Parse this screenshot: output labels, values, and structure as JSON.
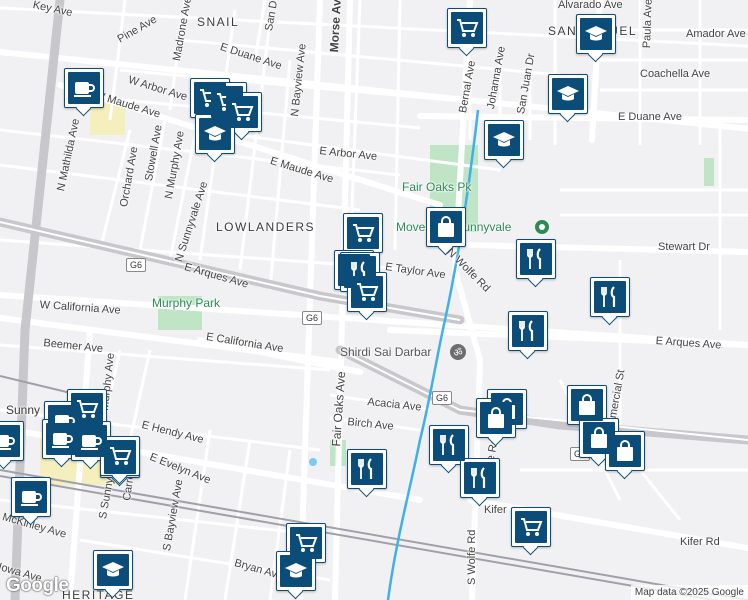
{
  "map": {
    "attribution": "Map data ©2025 Google",
    "logo": "Google",
    "colors": {
      "background": "#f1f0f3",
      "road": "#ffffff",
      "highway": "#c8c8cc",
      "rail": "#a0a0a8",
      "water": "#3fb0e8",
      "park": "#bfe5c6",
      "urban": "#f5eebd",
      "marker": "#0b4c78"
    },
    "labels": {
      "snail": "SNAIL",
      "lowlanders": "LOWLANDERS",
      "san_miguel": "SAN MIGUEL",
      "heritage": "HERITAGE",
      "sunnyvale": "Sunny",
      "murphy_park": "Murphy Park",
      "fair_oaks_park": "Fair Oaks Pk",
      "movement": "Movement Sunnyvale",
      "shirdi": "Shirdi Sai Darbar",
      "e_maude_ave": "E Maude Ave",
      "w_maude_ave": "W Maude Ave",
      "w_arbor_ave": "W Arbor Ave",
      "e_arbor_ave": "E Arbor Ave",
      "e_duane_ave_top": "E Duane Ave",
      "e_duane_ave_right": "E Duane Ave",
      "amador_ave": "Amador Ave",
      "coachella_ave": "Coachella Ave",
      "alvarado_ave": "Alvarado Ave",
      "stewart_dr": "Stewart Dr",
      "e_arques_ave_left": "E Arques Ave",
      "e_arques_ave_right": "E Arques Ave",
      "e_taylor_ave": "E Taylor Ave",
      "n_wolfe_rd": "N Wolfe Rd",
      "s_wolfe_rd": "S Wolfe Rd",
      "wolfe_rd_mid": "Wolfe Rd",
      "w_california_ave": "W California Ave",
      "e_california_ave": "E California Ave",
      "beemer_ave": "Beemer Ave",
      "acacia_ave": "Acacia Ave",
      "birch_ave": "Birch Ave",
      "e_hendy_ave": "E Hendy Ave",
      "e_evelyn_ave": "E Evelyn Ave",
      "kifer_rd_right": "Kifer Rd",
      "kifer_rd_mid": "Kifer",
      "mckinley_ave": "McKinley Ave",
      "iowa_ave": "Iowa Ave",
      "bryan_ave": "Bryan Ave",
      "n_mathilda_ave": "N Mathilda Ave",
      "n_sunnyvale_ave": "N Sunnyvale Ave",
      "s_sunnyvale_ave": "S Sunnyvale Ave",
      "s_murphy_ave": "Murphy Ave",
      "n_murphy_ave": "N Murphy Ave",
      "stowell_ave": "Stowell Ave",
      "orchard_ave": "Orchard Ave",
      "pine_ave": "Pine Ave",
      "madrone_ave": "Madrone Ave",
      "morse_ave": "Morse Ave",
      "n_bayview_ave": "N Bayview Ave",
      "s_bayview_ave": "S Bayview Ave",
      "fair_oaks_ave": "Fair Oaks Ave",
      "bernal_ave": "Bernal Ave",
      "johanna_ave": "Johanna Ave",
      "san_juan_dr": "San Juan Dr",
      "commercial_st": "Commercial St",
      "paula_ave": "Paula Ave",
      "carroll_st": "Carroll St",
      "key_ave": "Key Ave",
      "san_d": "San D",
      "g6_a": "G6",
      "g6_b": "G6",
      "g6_c": "G6",
      "g6_d": "G6"
    },
    "markers": [
      {
        "type": "grocery"
      },
      {
        "type": "school"
      },
      {
        "type": "cafe"
      },
      {
        "type": "grocery"
      },
      {
        "type": "grocery"
      },
      {
        "type": "grocery"
      },
      {
        "type": "school"
      },
      {
        "type": "school"
      },
      {
        "type": "school"
      },
      {
        "type": "grocery"
      },
      {
        "type": "shopping"
      },
      {
        "type": "restaurant"
      },
      {
        "type": "restaurant"
      },
      {
        "type": "grocery"
      },
      {
        "type": "restaurant"
      },
      {
        "type": "restaurant"
      },
      {
        "type": "restaurant"
      },
      {
        "type": "grocery"
      },
      {
        "type": "grocery"
      },
      {
        "type": "cafe"
      },
      {
        "type": "cafe"
      },
      {
        "type": "cafe"
      },
      {
        "type": "cafe"
      },
      {
        "type": "cafe"
      },
      {
        "type": "grocery"
      },
      {
        "type": "restaurant"
      },
      {
        "type": "restaurant"
      },
      {
        "type": "shopping"
      },
      {
        "type": "shopping"
      },
      {
        "type": "shopping"
      },
      {
        "type": "shopping"
      },
      {
        "type": "shopping"
      },
      {
        "type": "grocery"
      },
      {
        "type": "grocery"
      },
      {
        "type": "school"
      },
      {
        "type": "school"
      },
      {
        "type": "cafe"
      }
    ]
  }
}
